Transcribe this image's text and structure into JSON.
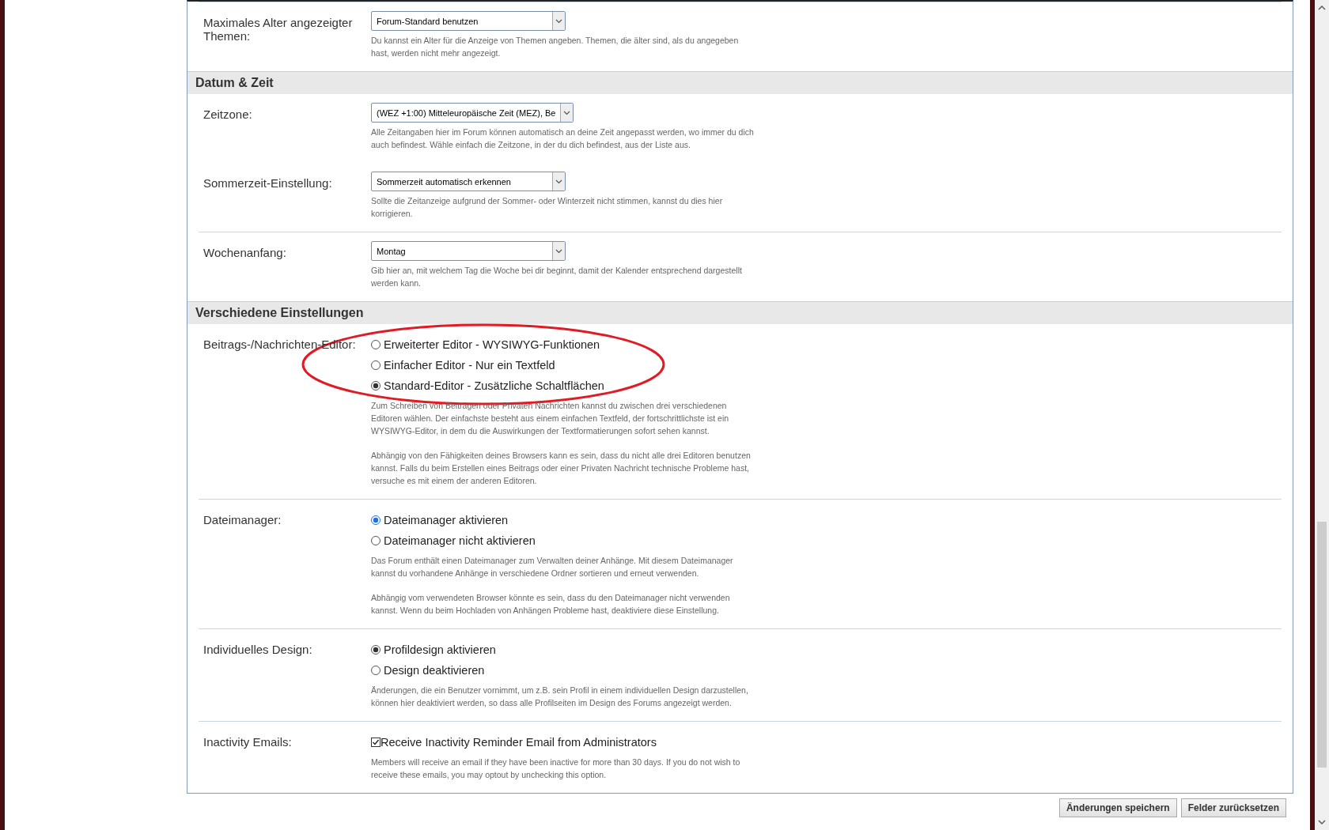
{
  "sections": [
    {
      "rows": [
        {
          "kind": "select",
          "divider_above": true,
          "label": "Maximales Alter angezeigter Themen:",
          "value": "Forum-Standard benutzen",
          "help": [
            "Du kannst ein Alter für die Anzeige von Themen angeben. Themen, die älter sind, als du angegeben hast, werden nicht mehr angezeigt."
          ]
        }
      ]
    },
    {
      "title": "Datum & Zeit",
      "rows": [
        {
          "kind": "select",
          "divider_above": false,
          "label": "Zeitzone:",
          "value": "(WEZ +1:00) Mitteleuropäische Zeit (MEZ), Be",
          "help": [
            "Alle Zeitangaben hier im Forum können automatisch an deine Zeit angepasst werden, wo immer du dich auch befindest. Wähle einfach die Zeitzone, in der du dich befindest, aus der Liste aus."
          ]
        },
        {
          "kind": "select",
          "divider_above": false,
          "label": "Sommerzeit-Einstellung:",
          "value": "Sommerzeit automatisch erkennen",
          "help": [
            "Sollte die Zeitanzeige aufgrund der Sommer- oder Winterzeit nicht stimmen, kannst du dies hier korrigieren."
          ]
        },
        {
          "kind": "select",
          "divider_above": true,
          "label": "Wochenanfang:",
          "value": "Montag",
          "help": [
            "Gib hier an, mit welchem Tag die Woche bei dir beginnt, damit der Kalender entsprechend dargestellt werden kann."
          ]
        }
      ]
    },
    {
      "title": "Verschiedene Einstellungen",
      "rows": [
        {
          "kind": "radio",
          "divider_above": false,
          "highlighted": true,
          "label": "Beitrags-/Nachrichten-Editor:",
          "options": [
            {
              "label": "Erweiterter Editor - WYSIWYG-Funktionen",
              "selected": false,
              "focused": false
            },
            {
              "label": "Einfacher Editor - Nur ein Textfeld",
              "selected": false,
              "focused": false
            },
            {
              "label": "Standard-Editor - Zusätzliche Schaltflächen",
              "selected": true,
              "focused": false
            }
          ],
          "help": [
            "Zum Schreiben von Beiträgen oder Privaten Nachrichten kannst du zwischen drei verschiedenen Editoren wählen. Der einfachste besteht aus einem einfachen Textfeld, der fortschrittlichste ist ein WYSIWYG-Editor, in dem du die Auswirkungen der Textformatierungen sofort sehen kannst.",
            "Abhängig von den Fähigkeiten deines Browsers kann es sein, dass du nicht alle drei Editoren benutzen kannst. Falls du beim Erstellen eines Beitrags oder einer Privaten Nachricht technische Probleme hast, versuche es mit einem der anderen Editoren."
          ]
        },
        {
          "kind": "radio",
          "divider_above": true,
          "highlighted": false,
          "label": "Dateimanager:",
          "options": [
            {
              "label": "Dateimanager aktivieren",
              "selected": true,
              "focused": true
            },
            {
              "label": "Dateimanager nicht aktivieren",
              "selected": false,
              "focused": false
            }
          ],
          "help": [
            "Das Forum enthält einen Dateimanager zum Verwalten deiner Anhänge. Mit diesem Dateimanager kannst du vorhandene Anhänge in verschiedene Ordner sortieren und erneut verwenden.",
            "Abhängig vom verwendeten Browser könnte es sein, dass du den Dateimanager nicht verwenden kannst. Wenn du beim Hochladen von Anhängen Probleme hast, deaktiviere diese Einstellung."
          ]
        },
        {
          "kind": "radio",
          "divider_above": true,
          "highlighted": false,
          "label": "Individuelles Design:",
          "options": [
            {
              "label": "Profildesign aktivieren",
              "selected": true,
              "focused": false
            },
            {
              "label": "Design deaktivieren",
              "selected": false,
              "focused": false
            }
          ],
          "help": [
            "Änderungen, die ein Benutzer vornimmt, um z.B. sein Profil in einem individuellen Design darzustellen, können hier deaktiviert werden, so dass alle Profilseiten im Design des Forums angezeigt werden."
          ]
        },
        {
          "kind": "checkbox",
          "divider_above": true,
          "label": "Inactivity Emails:",
          "option": "Receive Inactivity Reminder Email from Administrators",
          "checked": true,
          "help": [
            "Members will receive an email if they have been inactive for more than 30 days. If you do not wish to receive these emails, you may optout by unchecking this option."
          ]
        }
      ]
    }
  ],
  "buttons": [
    "Änderungen speichern",
    "Felder zurücksetzen"
  ]
}
